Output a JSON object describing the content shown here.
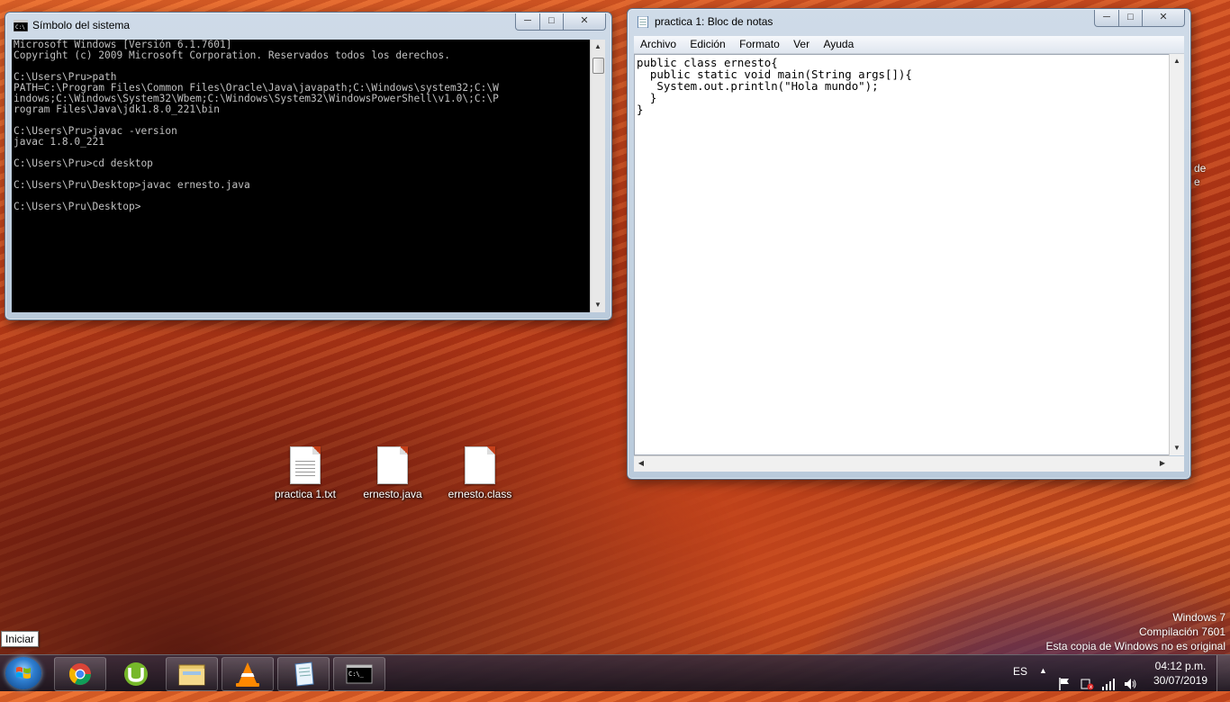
{
  "desktop": {
    "icons": [
      {
        "label": "practica 1.txt"
      },
      {
        "label": "ernesto.java"
      },
      {
        "label": "ernesto.class"
      }
    ],
    "side_fragment": [
      "de",
      "e"
    ]
  },
  "cmd_window": {
    "title": "Símbolo del sistema",
    "lines": [
      "Microsoft Windows [Versión 6.1.7601]",
      "Copyright (c) 2009 Microsoft Corporation. Reservados todos los derechos.",
      "",
      "C:\\Users\\Pru>path",
      "PATH=C:\\Program Files\\Common Files\\Oracle\\Java\\javapath;C:\\Windows\\system32;C:\\W",
      "indows;C:\\Windows\\System32\\Wbem;C:\\Windows\\System32\\WindowsPowerShell\\v1.0\\;C:\\P",
      "rogram Files\\Java\\jdk1.8.0_221\\bin",
      "",
      "C:\\Users\\Pru>javac -version",
      "javac 1.8.0_221",
      "",
      "C:\\Users\\Pru>cd desktop",
      "",
      "C:\\Users\\Pru\\Desktop>javac ernesto.java",
      "",
      "C:\\Users\\Pru\\Desktop>"
    ]
  },
  "notepad_window": {
    "title": "practica 1: Bloc de notas",
    "menu": [
      "Archivo",
      "Edición",
      "Formato",
      "Ver",
      "Ayuda"
    ],
    "content_lines": [
      "public class ernesto{",
      "  public static void main(String args[]){",
      "   System.out.println(\"Hola mundo\");",
      "  }",
      "}"
    ]
  },
  "window_controls": {
    "minimize": "─",
    "maximize": "□",
    "close": "✕"
  },
  "start_tooltip": "Iniciar",
  "watermark": {
    "line1": "Windows 7",
    "line2": "Compilación  7601",
    "line3": "Esta copia de Windows no es original"
  },
  "taskbar": {
    "pinned": [
      {
        "name": "chrome-icon"
      },
      {
        "name": "utorrent-icon"
      },
      {
        "name": "file-explorer-icon"
      },
      {
        "name": "vlc-icon"
      },
      {
        "name": "notepad-icon"
      },
      {
        "name": "cmd-icon"
      }
    ],
    "language": "ES",
    "time": "04:12 p.m.",
    "date": "30/07/2019"
  },
  "colors": {
    "cmd_bg": "#000000",
    "cmd_fg": "#c0c0c0",
    "window_frame": "#c5d5e6",
    "taskbar": "#2a2230"
  }
}
